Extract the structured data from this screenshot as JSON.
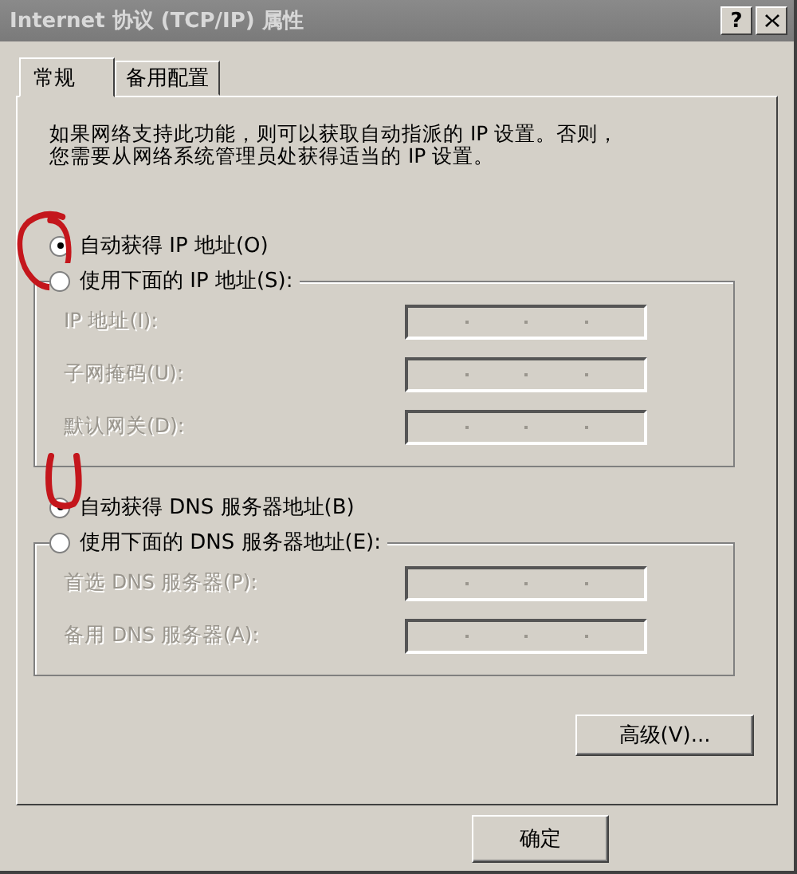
{
  "window": {
    "title": "Internet 协议 (TCP/IP) 属性",
    "help_button": "?"
  },
  "tabs": [
    {
      "label": "常规",
      "selected": true
    },
    {
      "label": "备用配置",
      "selected": false
    }
  ],
  "description": [
    "如果网络支持此功能，则可以获取自动指派的 IP 设置。否则，",
    "您需要从网络系统管理员处获得适当的 IP 设置。"
  ],
  "groups": [
    {
      "auto_option": {
        "label": "自动获得 IP 地址(O)",
        "selected": true
      },
      "manual_option": {
        "label": "使用下面的 IP 地址(S):",
        "selected": false
      },
      "fields": [
        {
          "label": "IP 地址(I):",
          "disabled": true
        },
        {
          "label": "子网掩码(U):",
          "disabled": true
        },
        {
          "label": "默认网关(D):",
          "disabled": true
        }
      ]
    },
    {
      "auto_option": {
        "label": "自动获得 DNS 服务器地址(B)",
        "selected": true
      },
      "manual_option": {
        "label": "使用下面的 DNS 服务器地址(E):",
        "selected": false
      },
      "fields": [
        {
          "label": "首选 DNS 服务器(P):",
          "disabled": true
        },
        {
          "label": "备用 DNS 服务器(A):",
          "disabled": true
        }
      ]
    }
  ],
  "advanced_button": "高级(V)...",
  "ok_button": "确定"
}
